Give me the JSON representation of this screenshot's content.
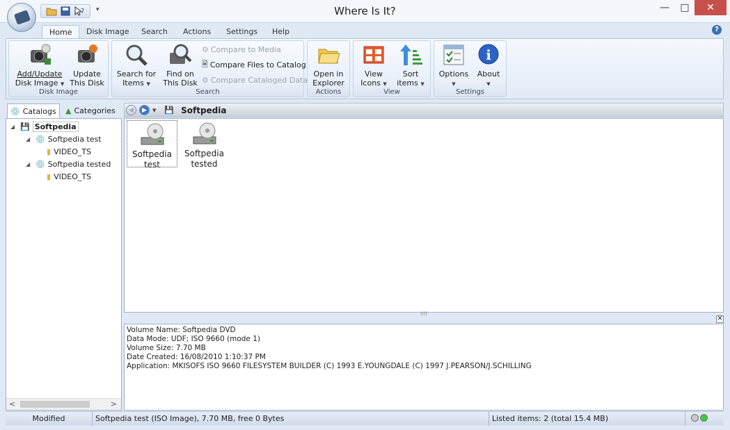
{
  "window": {
    "title": "Where Is It?"
  },
  "tabs": [
    {
      "label": "Home",
      "active": true
    },
    {
      "label": "Disk Image"
    },
    {
      "label": "Search"
    },
    {
      "label": "Actions"
    },
    {
      "label": "Settings"
    },
    {
      "label": "Help"
    }
  ],
  "ribbon": {
    "disk_image": {
      "label": "Disk Image",
      "add_update_line1": "Add/Update",
      "add_update_line2": "Disk Image",
      "update_line1": "Update",
      "update_line2": "This Disk"
    },
    "search": {
      "label": "Search",
      "search_for_line1": "Search for",
      "search_for_line2": "Items",
      "find_on_line1": "Find on",
      "find_on_line2": "This Disk",
      "compare_media": "Compare to Media",
      "compare_files": "Compare Files to Catalog",
      "compare_cataloged": "Compare Cataloged Data"
    },
    "actions": {
      "label": "Actions",
      "open_line1": "Open in",
      "open_line2": "Explorer"
    },
    "view": {
      "label": "View",
      "view_icons_line1": "View",
      "view_icons_line2": "Icons",
      "sort_line1": "Sort",
      "sort_line2": "items"
    },
    "settings": {
      "label": "Settings",
      "options": "Options",
      "about": "About"
    }
  },
  "left_tabs": {
    "catalogs": "Catalogs",
    "categories": "Categories"
  },
  "tree": {
    "root": "Softpedia",
    "children": [
      {
        "label": "Softpedia test",
        "child": "VIDEO_TS"
      },
      {
        "label": "Softpedia tested",
        "child": "VIDEO_TS"
      }
    ]
  },
  "breadcrumb": {
    "title": "Softpedia"
  },
  "items": [
    {
      "line1": "Softpedia",
      "line2": "test"
    },
    {
      "line1": "Softpedia",
      "line2": "tested"
    }
  ],
  "info": {
    "lines": [
      "Volume Name: Softpedia DVD",
      "Data Mode: UDF; ISO 9660 (mode 1)",
      "Volume Size: 7.70 MB",
      "Date Created: 16/08/2010 1:10:37 PM",
      "Application: MKISOFS ISO 9660 FILESYSTEM BUILDER (C) 1993 E.YOUNGDALE (C) 1997 J.PEARSON/J.SCHILLING"
    ]
  },
  "status": {
    "modified": "Modified",
    "selection": "Softpedia test (ISO Image), 7.70 MB, free 0 Bytes",
    "listed": "Listed items: 2 (total 15.4 MB)"
  }
}
